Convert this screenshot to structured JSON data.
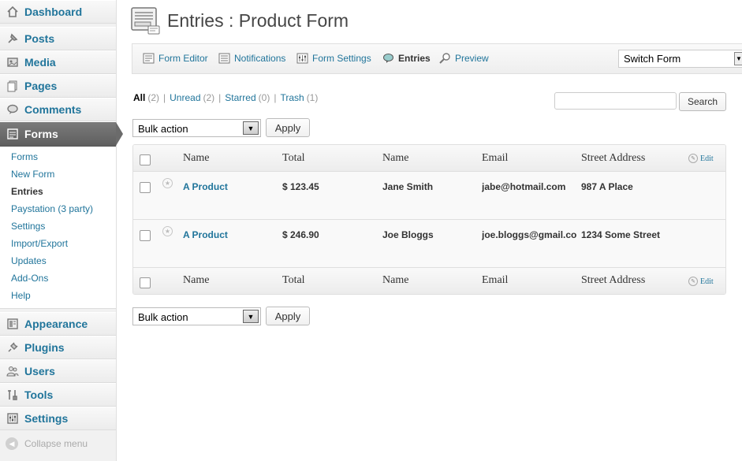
{
  "sidebar": {
    "items": [
      {
        "label": "Dashboard",
        "icon": "dashboard-icon"
      },
      {
        "label": "Posts",
        "icon": "pin-icon"
      },
      {
        "label": "Media",
        "icon": "media-icon"
      },
      {
        "label": "Pages",
        "icon": "pages-icon"
      },
      {
        "label": "Comments",
        "icon": "comment-icon"
      },
      {
        "label": "Forms",
        "icon": "forms-icon"
      },
      {
        "label": "Appearance",
        "icon": "appearance-icon"
      },
      {
        "label": "Plugins",
        "icon": "plug-icon"
      },
      {
        "label": "Users",
        "icon": "users-icon"
      },
      {
        "label": "Tools",
        "icon": "tools-icon"
      },
      {
        "label": "Settings",
        "icon": "settings-icon"
      }
    ],
    "submenu": [
      "Forms",
      "New Form",
      "Entries",
      "Paystation (3 party)",
      "Settings",
      "Import/Export",
      "Updates",
      "Add-Ons",
      "Help"
    ],
    "collapse_label": "Collapse menu"
  },
  "header": {
    "title": "Entries : Product Form"
  },
  "toolbar": {
    "form_editor": "Form Editor",
    "notifications": "Notifications",
    "form_settings": "Form Settings",
    "entries": "Entries",
    "preview": "Preview",
    "switch_form": "Switch Form"
  },
  "filters": {
    "all": {
      "label": "All",
      "count": "(2)"
    },
    "unread": {
      "label": "Unread",
      "count": "(2)"
    },
    "starred": {
      "label": "Starred",
      "count": "(0)"
    },
    "trash": {
      "label": "Trash",
      "count": "(1)"
    },
    "separator": "|"
  },
  "search": {
    "button": "Search",
    "value": ""
  },
  "bulk": {
    "label": "Bulk action",
    "apply": "Apply"
  },
  "table": {
    "columns": [
      "Name",
      "Total",
      "Name",
      "Email",
      "Street Address"
    ],
    "edit_label": "Edit",
    "rows": [
      [
        "A Product",
        "$ 123.45",
        "Jane Smith",
        "jabe@hotmail.com",
        "987 A Place"
      ],
      [
        "A Product",
        "$ 246.90",
        "Joe Bloggs",
        "joe.bloggs@gmail.com",
        "1234 Some Street"
      ]
    ]
  }
}
